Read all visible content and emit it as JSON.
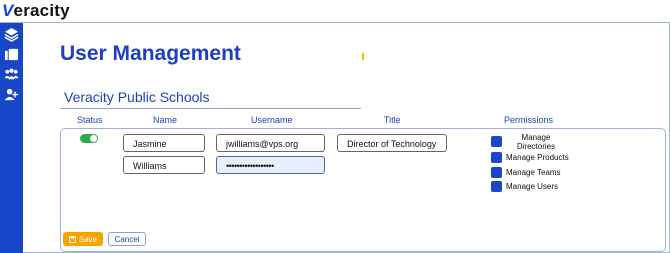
{
  "app": {
    "logo_v": "V",
    "logo_rest": "eracity"
  },
  "page": {
    "title": "User Management",
    "organization": "Veracity Public Schools"
  },
  "sidebar": {
    "items": [
      {
        "icon": "layers-icon"
      },
      {
        "icon": "copy-icon"
      },
      {
        "icon": "group-icon"
      },
      {
        "icon": "add-user-icon"
      }
    ]
  },
  "columns": {
    "status": "Status",
    "name": "Name",
    "username": "Username",
    "title": "Title",
    "permissions": "Permissions"
  },
  "user": {
    "status_on": true,
    "first_name": "Jasmine",
    "last_name": "Williams",
    "username": "jwilliams@vps.org",
    "password": "••••••••••••••••••",
    "title": "Director of Technology"
  },
  "permissions": [
    {
      "label": "Manage Directories"
    },
    {
      "label": "Manage Products"
    },
    {
      "label": "Manage Teams"
    },
    {
      "label": "Manage Users"
    }
  ],
  "actions": {
    "save": "Save",
    "cancel": "Cancel"
  },
  "colors": {
    "brand": "#1746c8",
    "title": "#1f3fbf",
    "toggle_on": "#2fa84f",
    "save": "#f5a300"
  }
}
